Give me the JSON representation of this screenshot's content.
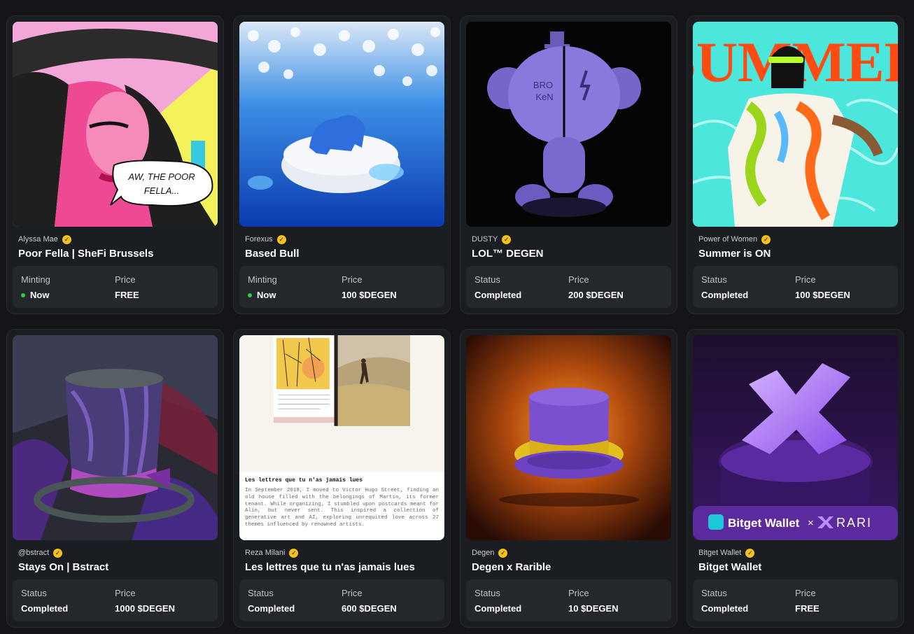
{
  "cards": [
    {
      "creator": "Alyssa Mae",
      "title": "Poor Fella | SheFi Brussels",
      "status_label": "Minting",
      "status_value": "Now",
      "live": true,
      "price_label": "Price",
      "price_value": "FREE",
      "art_text": [
        "AW, THE POOR",
        "FELLA..."
      ]
    },
    {
      "creator": "Forexus",
      "title": "Based Bull",
      "status_label": "Minting",
      "status_value": "Now",
      "live": true,
      "price_label": "Price",
      "price_value": "100 $DEGEN"
    },
    {
      "creator": "DUSTY",
      "title": "LOL™ DEGEN",
      "status_label": "Status",
      "status_value": "Completed",
      "live": false,
      "price_label": "Price",
      "price_value": "200 $DEGEN",
      "art_text": [
        "BRO",
        "KeN"
      ]
    },
    {
      "creator": "Power of Women",
      "title": "Summer is ON",
      "status_label": "Status",
      "status_value": "Completed",
      "live": false,
      "price_label": "Price",
      "price_value": "100 $DEGEN",
      "art_text": [
        "SUMMER"
      ]
    },
    {
      "creator": "@bstract",
      "title": "Stays On | Bstract",
      "status_label": "Status",
      "status_value": "Completed",
      "live": false,
      "price_label": "Price",
      "price_value": "1000 $DEGEN"
    },
    {
      "creator": "Reza Milani",
      "title": "Les lettres que tu n'as jamais lues",
      "status_label": "Status",
      "status_value": "Completed",
      "live": false,
      "price_label": "Price",
      "price_value": "600 $DEGEN",
      "art_text": [
        "Les lettres que tu n'as jamais lues",
        "In September 2018, I moved to Victor Hugo Street, finding an old house filled with the belongings of Martin, its former tenant. While organizing, I stumbled upon postcards meant for Alin, but never sent. This inspired a collection of generative art and AI, exploring unrequited love across 27 themes influenced by renowned artists."
      ]
    },
    {
      "creator": "Degen",
      "title": "Degen x Rarible",
      "status_label": "Status",
      "status_value": "Completed",
      "live": false,
      "price_label": "Price",
      "price_value": "10 $DEGEN"
    },
    {
      "creator": "Bitget Wallet",
      "title": "Bitget Wallet",
      "status_label": "Status",
      "status_value": "Completed",
      "live": false,
      "price_label": "Price",
      "price_value": "FREE",
      "art_text": [
        "Bitget Wallet",
        "×",
        "RARI"
      ]
    }
  ],
  "colors": {
    "verified": "#f5c21b",
    "live_dot": "#2ecc40",
    "card_bg": "#1a1d21",
    "info_bg": "#24272c"
  }
}
